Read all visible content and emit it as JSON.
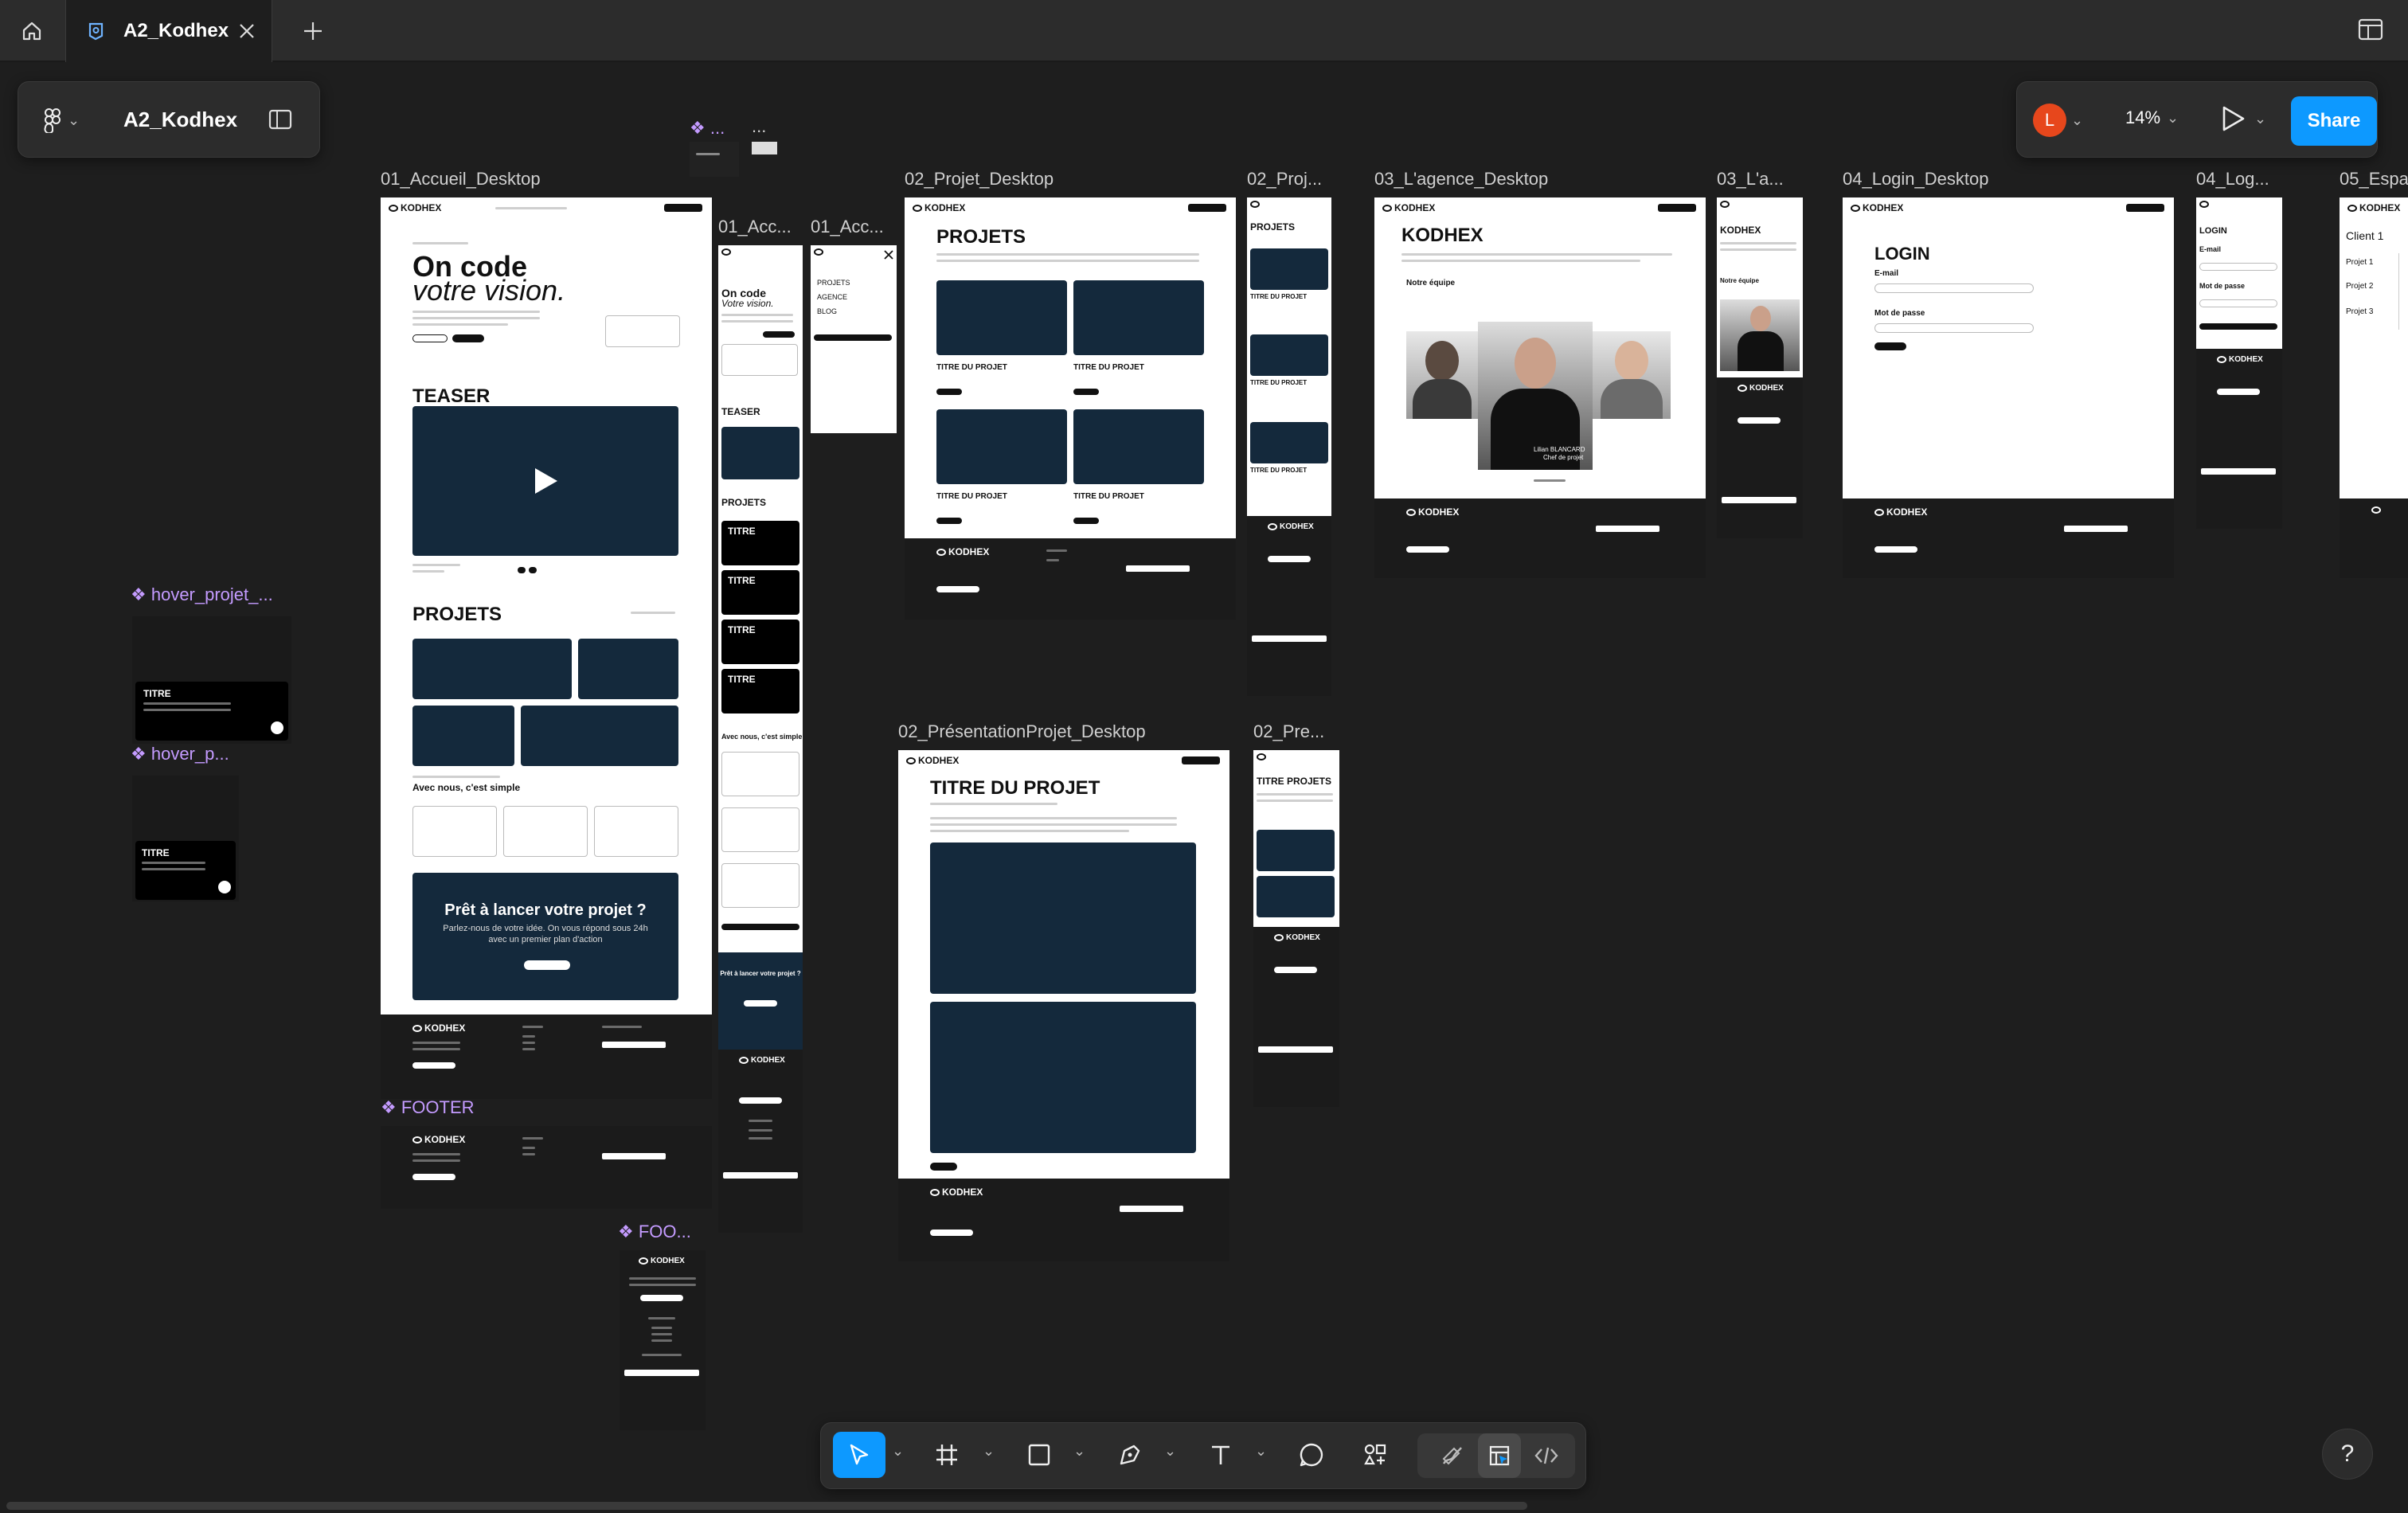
{
  "app": {
    "tab_title": "A2_Kodhex",
    "file_name": "A2_Kodhex",
    "zoom": "14%",
    "share_label": "Share",
    "avatar_letter": "L",
    "accent": "#0d99ff",
    "avatar_color": "#e7471c"
  },
  "frames": {
    "accueil_desktop": "01_Accueil_Desktop",
    "accueil_tablet": "01_Acc...",
    "accueil_mobile": "01_Acc...",
    "projet_desktop": "02_Projet_Desktop",
    "projet_mobile": "02_Proj...",
    "agence_desktop": "03_L'agence_Desktop",
    "agence_mobile": "03_L'a...",
    "login_desktop": "04_Login_Desktop",
    "login_mobile": "04_Log...",
    "espace": "05_Espa",
    "presentation_desktop": "02_PrésentationProjet_Desktop",
    "presentation_mobile": "02_Pre...",
    "hover1": "hover_projet_...",
    "hover2": "hover_p...",
    "footer": "FOOTER",
    "footer_mobile": "FOO...",
    "top_comp": "...",
    "top_dots": "..."
  },
  "accueil": {
    "hero_l1": "On code",
    "hero_l2": "votre vision.",
    "teaser": "TEASER",
    "projets": "PROJETS",
    "simple": "Avec nous, c'est simple",
    "cta_title": "Prêt à lancer votre projet ?",
    "cta_sub1": "Parlez-nous de votre idée. On vous répond sous 24h",
    "cta_sub2": "avec un premier plan d'action"
  },
  "tablet": {
    "teaser": "TEASER",
    "projets": "PROJETS",
    "titre": "TITRE",
    "hero1": "On code",
    "hero2": "Votre vision.",
    "simple": "Avec nous, c'est simple",
    "cta": "Prêt à lancer votre projet ?"
  },
  "mobile_menu": {
    "items": [
      "PROJETS",
      "AGENCE",
      "BLOG"
    ]
  },
  "projet": {
    "title": "PROJETS",
    "card_title": "TITRE DU PROJET",
    "mobile_title": "PROJETS"
  },
  "agence": {
    "title": "KODHEX",
    "team": "Notre équipe",
    "member_name": "Lilian BLANCARD",
    "member_role": "Chef de projet"
  },
  "login": {
    "title": "LOGIN",
    "email": "E-mail",
    "password": "Mot de passe"
  },
  "espace": {
    "client": "Client 1",
    "projects": [
      "Projet 1",
      "Projet 2",
      "Projet 3"
    ]
  },
  "presentation": {
    "title": "TITRE DU PROJET",
    "mobile_title": "TITRE PROJETS"
  },
  "hover": {
    "titre": "TITRE"
  },
  "logo": "KODHEX",
  "icons": {
    "home": "home-icon",
    "tab": "figma-file-icon",
    "close": "close-icon",
    "plus": "plus-icon",
    "panel": "sidebar-icon",
    "play": "play-icon",
    "move": "move-tool-icon",
    "frame": "frame-tool-icon",
    "rect": "rectangle-tool-icon",
    "pen": "pen-tool-icon",
    "text": "text-tool-icon",
    "comment": "comment-tool-icon",
    "assets": "assets-icon",
    "draw": "draw-mode-icon",
    "design": "design-mode-icon",
    "dev": "dev-mode-icon",
    "help": "help-icon"
  }
}
